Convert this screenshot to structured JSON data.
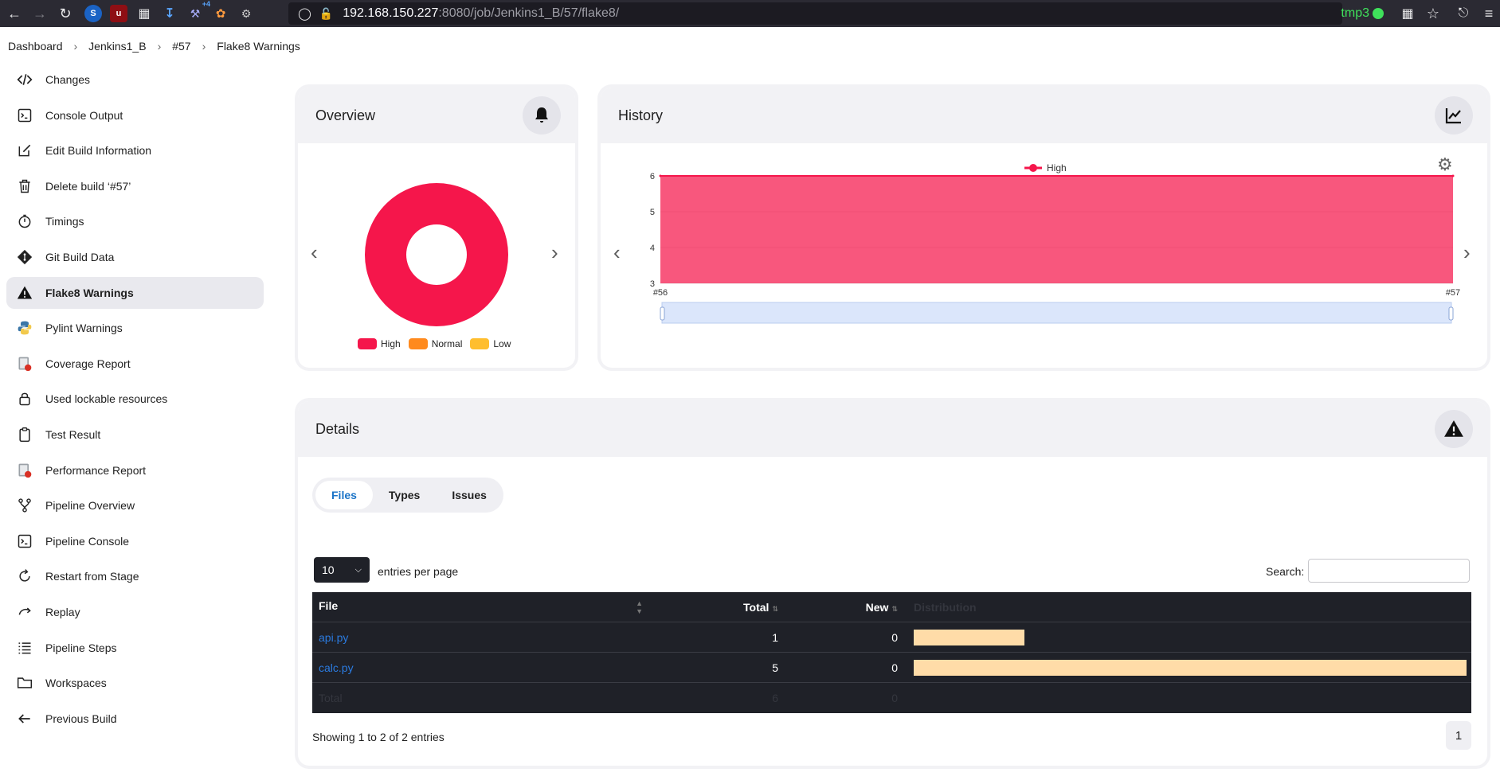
{
  "browser": {
    "url_host": "192.168.150.227",
    "url_rest": ":8080/job/Jenkins1_B/57/flake8/",
    "profile": "tmp3",
    "extension_badge": "+4"
  },
  "breadcrumb": [
    "Dashboard",
    "Jenkins1_B",
    "#57",
    "Flake8 Warnings"
  ],
  "sidebar": {
    "items": [
      {
        "label": "Changes",
        "icon": "code-icon"
      },
      {
        "label": "Console Output",
        "icon": "terminal-icon"
      },
      {
        "label": "Edit Build Information",
        "icon": "edit-icon"
      },
      {
        "label": "Delete build ‘#57’",
        "icon": "trash-icon"
      },
      {
        "label": "Timings",
        "icon": "stopwatch-icon"
      },
      {
        "label": "Git Build Data",
        "icon": "git-icon"
      },
      {
        "label": "Flake8 Warnings",
        "icon": "warning-icon",
        "active": true
      },
      {
        "label": "Pylint Warnings",
        "icon": "python-icon"
      },
      {
        "label": "Coverage Report",
        "icon": "coverage-icon"
      },
      {
        "label": "Used lockable resources",
        "icon": "lock-icon"
      },
      {
        "label": "Test Result",
        "icon": "clipboard-icon"
      },
      {
        "label": "Performance Report",
        "icon": "performance-icon"
      },
      {
        "label": "Pipeline Overview",
        "icon": "pipeline-icon"
      },
      {
        "label": "Pipeline Console",
        "icon": "terminal-icon"
      },
      {
        "label": "Restart from Stage",
        "icon": "restart-icon"
      },
      {
        "label": "Replay",
        "icon": "replay-icon"
      },
      {
        "label": "Pipeline Steps",
        "icon": "list-icon"
      },
      {
        "label": "Workspaces",
        "icon": "folder-icon"
      },
      {
        "label": "Previous Build",
        "icon": "arrow-left-icon"
      }
    ]
  },
  "overview": {
    "title": "Overview",
    "legend": [
      {
        "label": "High",
        "color": "#f5164b"
      },
      {
        "label": "Normal",
        "color": "#ff8a1e"
      },
      {
        "label": "Low",
        "color": "#ffbe2e"
      }
    ]
  },
  "history": {
    "title": "History",
    "legend_label": "High"
  },
  "details": {
    "title": "Details",
    "tabs": [
      "Files",
      "Types",
      "Issues"
    ],
    "active_tab": "Files",
    "entries_value": "10",
    "entries_label": "entries per page",
    "search_label": "Search:",
    "columns": [
      "File",
      "Total",
      "New",
      "Distribution"
    ],
    "rows": [
      {
        "file": "api.py",
        "total": "1",
        "new": "0",
        "dist": 0.2
      },
      {
        "file": "calc.py",
        "total": "5",
        "new": "0",
        "dist": 1.0
      }
    ],
    "footer": {
      "label": "Total",
      "total": "6",
      "new": "0"
    },
    "showing": "Showing 1 to 2 of 2 entries",
    "page": "1"
  },
  "chart_data": [
    {
      "type": "pie",
      "title": "",
      "labels": [
        "High",
        "Normal",
        "Low"
      ],
      "values": [
        6,
        0,
        0
      ],
      "colors": [
        "#f5164b",
        "#ff8a1e",
        "#ffbe2e"
      ],
      "legend": "bottom"
    },
    {
      "type": "area",
      "title": "",
      "x": [
        "#56",
        "#57"
      ],
      "series": [
        {
          "name": "High",
          "values": [
            6,
            6
          ],
          "color": "#f5164b"
        }
      ],
      "ylim": [
        3,
        6
      ],
      "yticks": [
        3,
        4,
        5,
        6
      ],
      "legend": "top"
    }
  ]
}
